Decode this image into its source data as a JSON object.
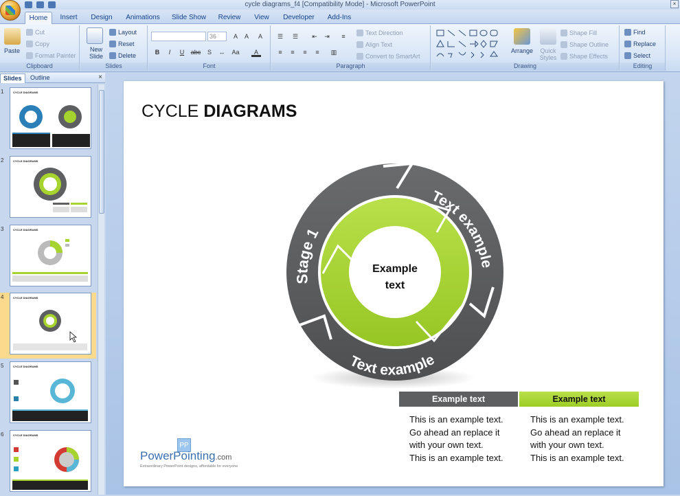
{
  "window": {
    "title": "cycle diagrams_f4 [Compatibility Mode] - Microsoft PowerPoint"
  },
  "tabs": [
    "Home",
    "Insert",
    "Design",
    "Animations",
    "Slide Show",
    "Review",
    "View",
    "Developer",
    "Add-Ins"
  ],
  "ribbon": {
    "clipboard": {
      "label": "Clipboard",
      "paste": "Paste",
      "cut": "Cut",
      "copy": "Copy",
      "format_painter": "Format Painter"
    },
    "slides": {
      "label": "Slides",
      "new_slide": "New Slide",
      "layout": "Layout",
      "reset": "Reset",
      "delete": "Delete"
    },
    "font": {
      "label": "Font",
      "size": "36",
      "bold": "B",
      "italic": "I",
      "underline": "U",
      "strike": "abc",
      "shadow": "S"
    },
    "paragraph": {
      "label": "Paragraph",
      "text_direction": "Text Direction",
      "align_text": "Align Text",
      "convert": "Convert to SmartArt"
    },
    "drawing": {
      "label": "Drawing",
      "arrange": "Arrange",
      "quick_styles": "Quick Styles",
      "shape_fill": "Shape Fill",
      "shape_outline": "Shape Outline",
      "shape_effects": "Shape Effects"
    },
    "editing": {
      "label": "Editing",
      "find": "Find",
      "replace": "Replace",
      "select": "Select"
    }
  },
  "panel": {
    "tab_slides": "Slides",
    "tab_outline": "Outline",
    "close": "×"
  },
  "thumbnails": [
    {
      "num": "1",
      "title": "CYCLE DIAGRAMS"
    },
    {
      "num": "2",
      "title": "CYCLE DIAGRAMS"
    },
    {
      "num": "3",
      "title": "CYCLE DIAGRAMS"
    },
    {
      "num": "4",
      "title": "CYCLE DIAGRAMS"
    },
    {
      "num": "5",
      "title": "CYCLE DIAGRAMS"
    },
    {
      "num": "6",
      "title": "CYCLE DIAGRAMS"
    }
  ],
  "slide": {
    "title_normal": "CYCLE ",
    "title_bold": "DIAGRAMS",
    "center_line1": "Example",
    "center_line2": "text",
    "label_stage": "Stage 1",
    "label_right": "Text example",
    "label_bottom": "Text example",
    "col1_header": "Example text",
    "col2_header": "Example text",
    "col1_lines": [
      "This is an example text.",
      "Go ahead an replace it",
      "with your own text.",
      "This is an example text."
    ],
    "col2_lines": [
      "This is an example text.",
      "Go ahead an replace it",
      "with your own text.",
      "This is an example text."
    ],
    "logo_name": "PowerPointing",
    "logo_suffix": ".com",
    "logo_badge": "PP",
    "logo_tagline": "Extraordinary PowerPoint designs, affordable for everyone"
  },
  "colors": {
    "gray_ring": "#5f6062",
    "green": "#a7d32f",
    "dark_header": "#5e5f61",
    "green_header": "#a8d433"
  }
}
